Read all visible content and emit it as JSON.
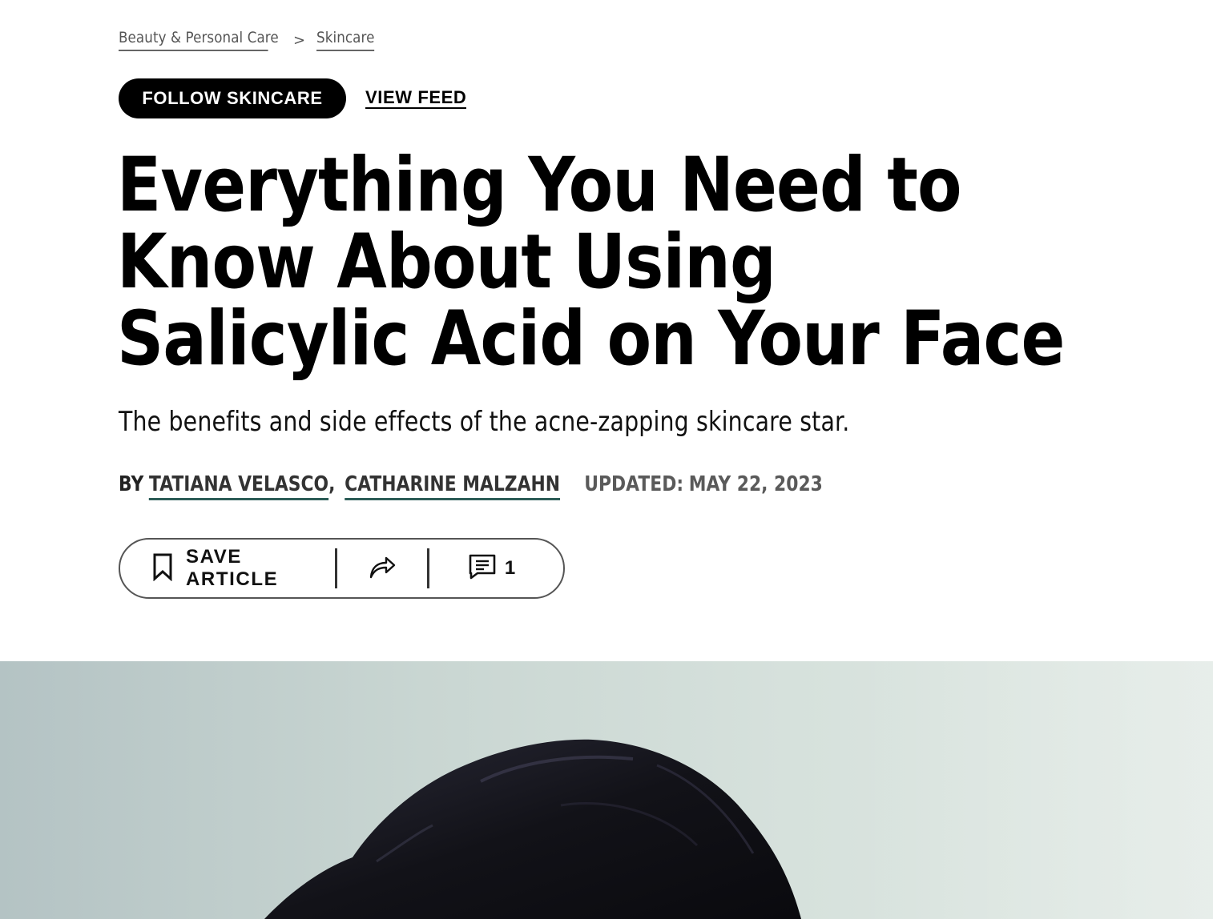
{
  "breadcrumb": {
    "items": [
      "Beauty & Personal Care",
      "Skincare"
    ],
    "separator": ">"
  },
  "follow": {
    "button_label": "FOLLOW SKINCARE",
    "view_feed_label": "VIEW FEED"
  },
  "article": {
    "headline": "Everything You Need to Know About Using Salicylic Acid on Your Face",
    "dek": "The benefits and side effects of the acne-zapping skincare star.",
    "byline": {
      "prefix": "BY",
      "authors": [
        "TATIANA VELASCO",
        "CATHARINE MALZAHN"
      ],
      "updated_label": "UPDATED:",
      "updated_date": "MAY 22, 2023"
    }
  },
  "actions": {
    "save_label": "SAVE ARTICLE",
    "save_icon": "bookmark-icon",
    "share_icon": "share-arrow-icon",
    "comment_icon": "comment-icon",
    "comment_count": "1"
  },
  "hero": {
    "subject": "person-with-dark-hair-photo",
    "background_color": "#d0dcd6",
    "hair_color": "#121218"
  },
  "colors": {
    "text": "#000000",
    "meta_text": "#5a5a5a",
    "author_underline": "#2c5c57",
    "button_bg": "#000000",
    "button_text": "#ffffff"
  }
}
